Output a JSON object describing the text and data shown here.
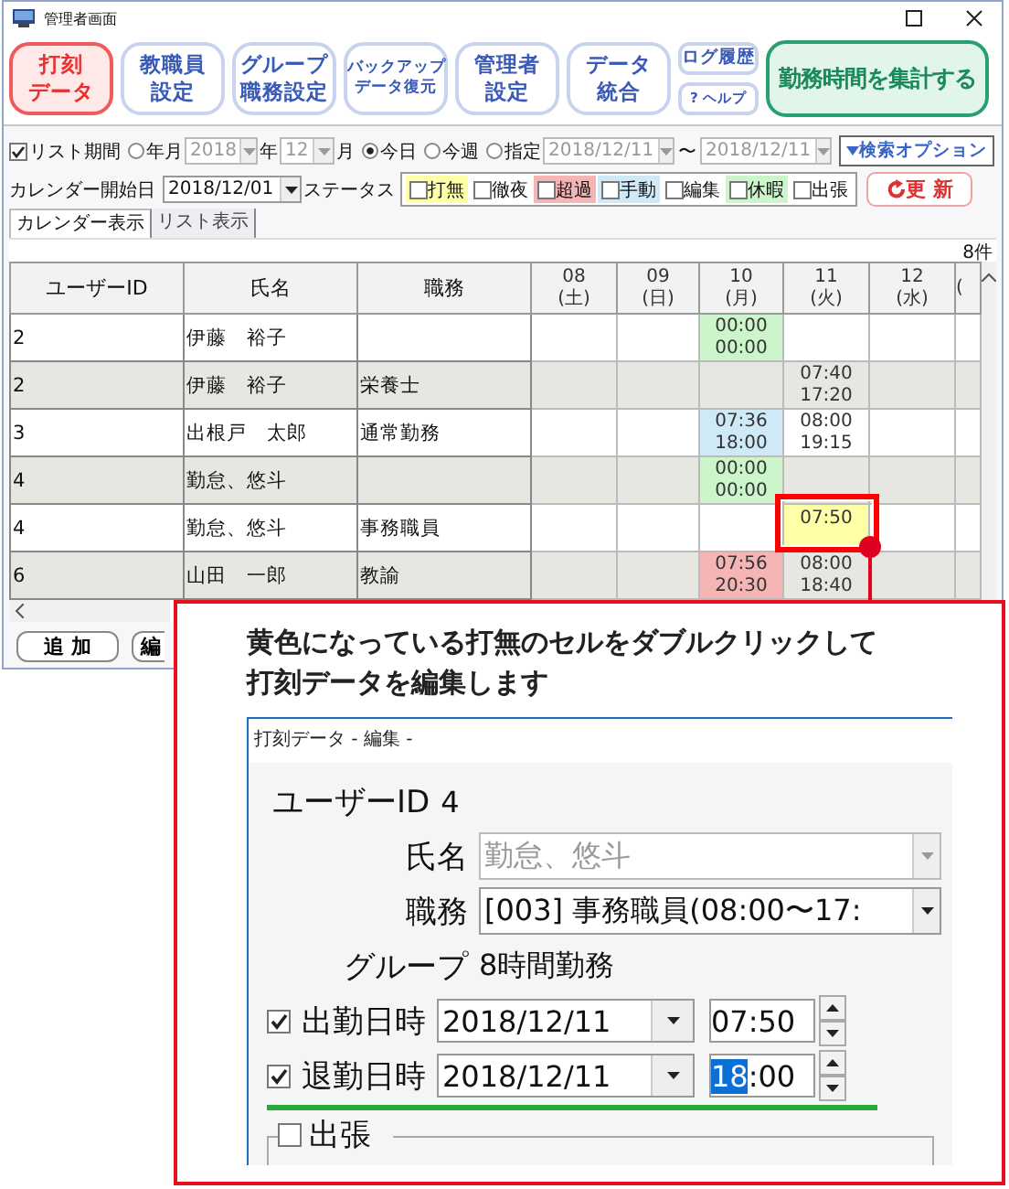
{
  "window": {
    "title": "管理者画面"
  },
  "toolbar": [
    {
      "kind": "main",
      "lines": [
        "打刻",
        "データ"
      ],
      "selected": true
    },
    {
      "kind": "main",
      "lines": [
        "教職員",
        "設定"
      ],
      "selected": false
    },
    {
      "kind": "main",
      "lines": [
        "グループ",
        "職務設定"
      ],
      "selected": false
    },
    {
      "kind": "main",
      "lines": [
        "バックアップ",
        "データ復元"
      ],
      "selected": false
    },
    {
      "kind": "main",
      "lines": [
        "管理者",
        "設定"
      ],
      "selected": false
    },
    {
      "kind": "main",
      "lines": [
        "データ",
        "統合"
      ],
      "selected": false
    },
    {
      "kind": "small",
      "lines": [
        "ログ履歴"
      ],
      "selected": false
    },
    {
      "kind": "small",
      "lines": [
        "? ヘルプ"
      ],
      "selected": false
    },
    {
      "kind": "action",
      "lines": [
        "勤務時間を集計する"
      ],
      "selected": false
    }
  ],
  "filter": {
    "list_period": {
      "label": "リスト期間",
      "checked": true
    },
    "year_month": {
      "label": "年月",
      "selected": false,
      "year": "2018",
      "year_unit": "年",
      "month": "12",
      "month_unit": "月"
    },
    "today": {
      "label": "今日",
      "selected": true
    },
    "this_week": {
      "label": "今週",
      "selected": false
    },
    "range": {
      "label": "指定",
      "selected": false,
      "from": "2018/12/11",
      "separator": "〜",
      "to": "2018/12/11"
    },
    "search_options": "検索オプション"
  },
  "calendar_start": {
    "label": "カレンダー開始日",
    "value": "2018/12/01"
  },
  "status": {
    "label": "ステータス",
    "items": [
      {
        "label": "打無",
        "checked": false,
        "color": "#ffffa8"
      },
      {
        "label": "徹夜",
        "checked": false
      },
      {
        "label": "超過",
        "checked": false,
        "color": "#f5b5b5"
      },
      {
        "label": "手動",
        "checked": false,
        "color": "#cfe9f7"
      },
      {
        "label": "編集",
        "checked": false
      },
      {
        "label": "休暇",
        "checked": false,
        "color": "#ccf5cc"
      },
      {
        "label": "出張",
        "checked": false
      }
    ]
  },
  "refresh": "更 新",
  "tabs": [
    {
      "label": "カレンダー表示",
      "selected": true
    },
    {
      "label": "リスト表示",
      "selected": false
    }
  ],
  "count": "8件",
  "table": {
    "columns": [
      "ユーザーID",
      "氏名",
      "職務"
    ],
    "day_columns": [
      [
        "08",
        "(土)"
      ],
      [
        "09",
        "(日)"
      ],
      [
        "10",
        "(月)"
      ],
      [
        "11",
        "(火)"
      ],
      [
        "12",
        "(水)"
      ],
      [
        "("
      ]
    ],
    "rows": [
      {
        "user_id": "2",
        "name": "伊藤　裕子",
        "days": [
          {
            "kind": "empty"
          },
          {
            "kind": "empty"
          },
          {
            "kind": "time",
            "lines": [
              "00:00",
              "00:00"
            ],
            "color": "#ccf5cc"
          },
          {
            "kind": "empty"
          },
          {
            "kind": "empty"
          },
          {
            "kind": "empty"
          }
        ]
      },
      {
        "user_id": "2",
        "name": "伊藤　裕子",
        "job": "栄養士",
        "days": [
          {
            "kind": "empty"
          },
          {
            "kind": "empty"
          },
          {
            "kind": "empty"
          },
          {
            "kind": "time",
            "lines": [
              "07:40",
              "17:20"
            ]
          },
          {
            "kind": "empty"
          },
          {
            "kind": "empty"
          }
        ]
      },
      {
        "user_id": "3",
        "name": "出根戸　太郎",
        "job": "通常勤務",
        "days": [
          {
            "kind": "empty"
          },
          {
            "kind": "empty"
          },
          {
            "kind": "time",
            "lines": [
              "07:36",
              "18:00"
            ],
            "color": "#cfe9f7"
          },
          {
            "kind": "time",
            "lines": [
              "08:00",
              "19:15"
            ]
          },
          {
            "kind": "empty"
          },
          {
            "kind": "empty"
          }
        ]
      },
      {
        "user_id": "4",
        "name": "勤怠、悠斗",
        "days": [
          {
            "kind": "empty"
          },
          {
            "kind": "empty"
          },
          {
            "kind": "time",
            "lines": [
              "00:00",
              "00:00"
            ],
            "color": "#ccf5cc"
          },
          {
            "kind": "empty"
          },
          {
            "kind": "empty"
          },
          {
            "kind": "empty"
          }
        ]
      },
      {
        "user_id": "4",
        "name": "勤怠、悠斗",
        "job": "事務職員",
        "days": [
          {
            "kind": "empty"
          },
          {
            "kind": "empty"
          },
          {
            "kind": "empty"
          },
          {
            "kind": "time",
            "lines": [
              "07:50"
            ],
            "color": "#ffffa8",
            "highlighted": true
          },
          {
            "kind": "empty"
          },
          {
            "kind": "empty"
          }
        ]
      },
      {
        "user_id": "6",
        "name": "山田　一郎",
        "job": "教諭",
        "days": [
          {
            "kind": "empty"
          },
          {
            "kind": "empty"
          },
          {
            "kind": "time",
            "lines": [
              "07:56",
              "20:30"
            ],
            "color": "#f5b5b5"
          },
          {
            "kind": "time",
            "lines": [
              "08:00",
              "18:40"
            ]
          },
          {
            "kind": "empty"
          },
          {
            "kind": "empty"
          }
        ]
      }
    ]
  },
  "bottom_buttons": [
    {
      "kind": "full",
      "label": "追 加"
    },
    {
      "kind": "cut",
      "label": "編"
    }
  ],
  "callout": {
    "lines": [
      "黄色になっている打無のセルをダブルクリックして",
      "打刻データを編集します"
    ],
    "dialog": {
      "title": "打刻データ - 編集 -",
      "user_id": {
        "label": "ユーザーID",
        "value": "4"
      },
      "name": {
        "label": "氏名",
        "value": "勤怠、悠斗",
        "disabled": true
      },
      "job": {
        "label": "職務",
        "value": "[003] 事務職員(08:00〜17:",
        "disabled": false
      },
      "group": {
        "label": "グループ",
        "value": "8時間勤務"
      },
      "times": [
        {
          "label": "出勤日時",
          "checked": true,
          "date": "2018/12/11",
          "time_parts": [
            {
              "text": "07:50",
              "selected": false
            }
          ]
        },
        {
          "label": "退勤日時",
          "checked": true,
          "date": "2018/12/11",
          "time_parts": [
            {
              "text": "18",
              "selected": true
            },
            {
              "text": ":00",
              "selected": false
            }
          ]
        }
      ],
      "trip": {
        "label": "出張",
        "checked": false
      }
    }
  }
}
